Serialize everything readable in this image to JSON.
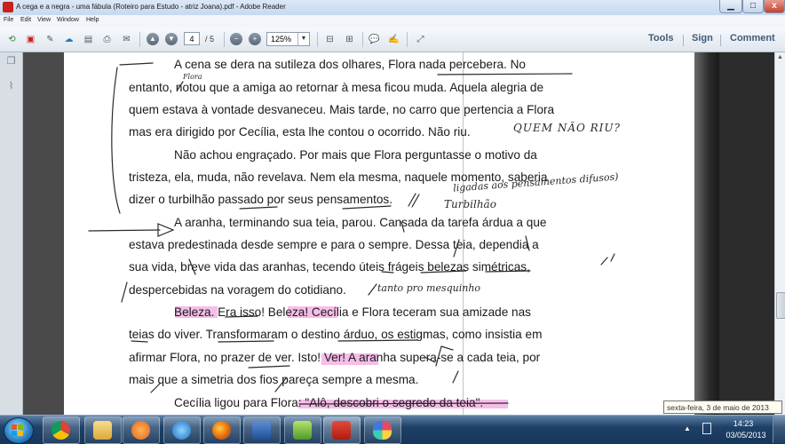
{
  "window": {
    "title": "A cega e a negra - uma fábula (Roteiro para Estudo - atriz Joana).pdf - Adobe Reader",
    "minimize_glyph": "▁",
    "maximize_glyph": "□",
    "close_glyph": "x"
  },
  "menu": [
    "File",
    "Edit",
    "View",
    "Window",
    "Help"
  ],
  "toolbar": {
    "current_page": "4",
    "total_pages": "/ 5",
    "zoom": "125%",
    "right_links": [
      "Tools",
      "Sign",
      "Comment"
    ]
  },
  "document": {
    "lines": [
      "A cena se dera na sutileza dos olhares, Flora nada percebera. No",
      "entanto, notou que a amiga ao retornar à mesa ficou muda. Aquela alegria de",
      "quem estava à vontade desvaneceu. Mais tarde, no carro que pertencia a Flora",
      "mas era dirigido por Cecília, esta lhe contou o ocorrido. Não riu.",
      "Não achou engraçado. Por mais que Flora perguntasse o motivo da",
      "tristeza, ela, muda, não revelava. Nem ela mesma, naquele momento, saberia",
      "dizer o turbilhão passado por seus pensamentos.",
      "A aranha, terminando sua teia, parou. Cansada da tarefa árdua a que",
      "estava predestinada desde sempre e para o sempre. Dessa teia, dependia a",
      "sua vida, breve vida das aranhas, tecendo úteis frágeis belezas simétricas,",
      "despercebidas na voragem do cotidiano.",
      "Beleza. Era isso! Beleza! Cecília e Flora teceram sua amizade nas",
      "teias do viver. Transformaram o destino árduo, os estigmas, como insistia em",
      "afirmar Flora, no prazer de ver. Isto! Ver! A aranha supera-se a cada teia, por",
      "mais que a simetria dos fios pareça sempre a mesma.",
      "Cecília ligou para Flora: \"Alô, descobri o segredo da teia\"."
    ],
    "handwritten": [
      "Flora",
      "QUEM NÃO RIU?",
      "ligadas aos pensamentos difusos)",
      "Turbilhão",
      "tanto pro mesquinho"
    ]
  },
  "tooltip": "sexta-feira, 3 de maio de 2013",
  "taskbar": {
    "apps": [
      "google-chrome-app",
      "file-explorer-app",
      "media-player-app",
      "internet-explorer-app",
      "firefox-app",
      "word-app",
      "games-app",
      "adobe-reader-app",
      "paint-app"
    ],
    "tray_arrow": "▲",
    "clock_time": "14:23",
    "clock_date": "03/05/2013"
  },
  "colors": {
    "highlight": "#f3a7e2",
    "accent_text": "#3f5a75",
    "taskbar": "#1f4167",
    "reader_red": "#c8201a"
  }
}
